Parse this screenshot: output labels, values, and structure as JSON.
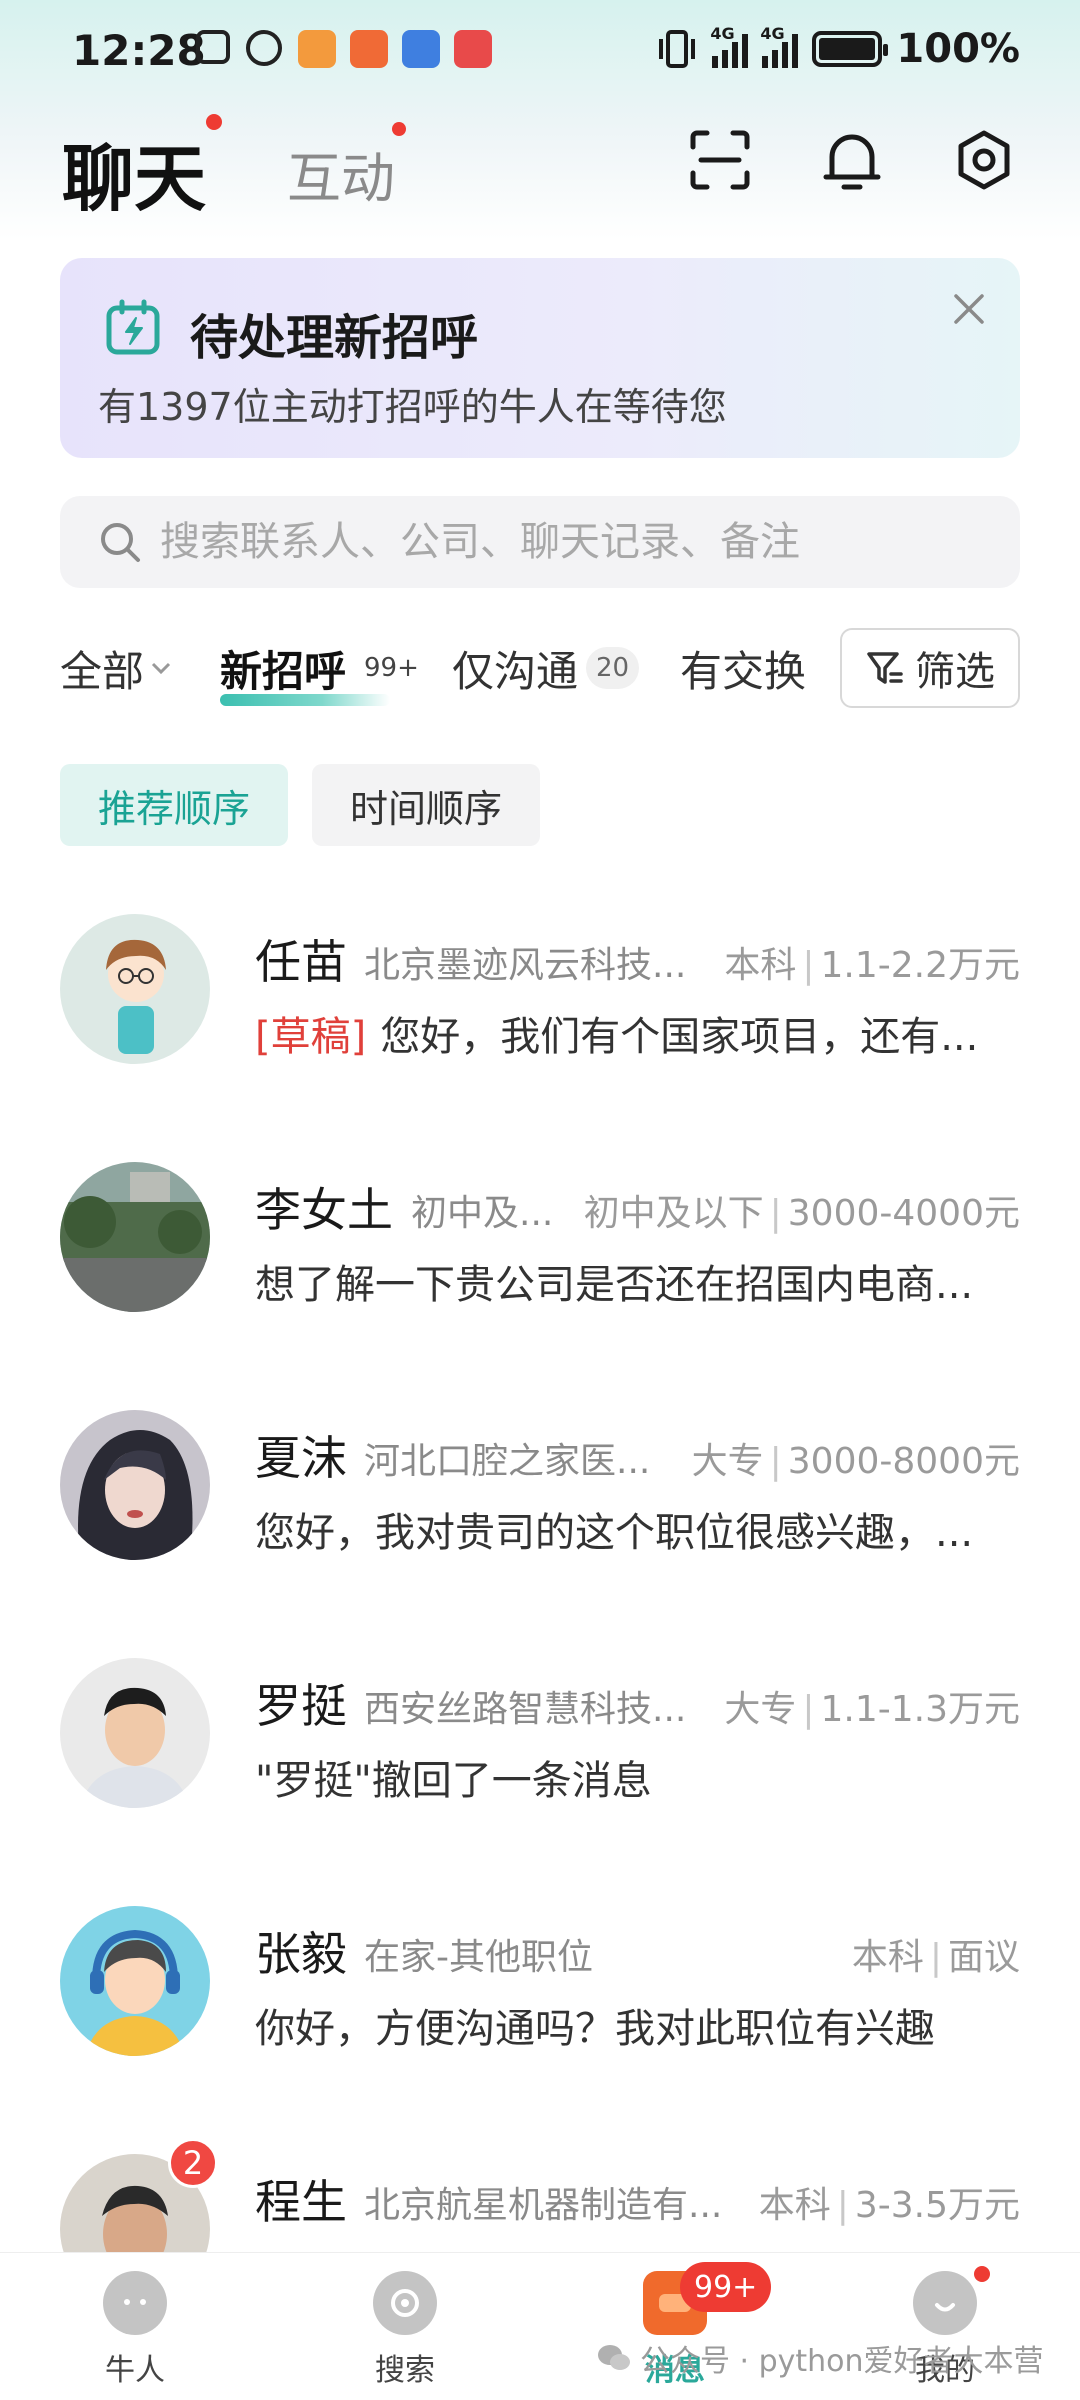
{
  "status_bar": {
    "time": "12:28",
    "signal_1_label": "4G",
    "signal_2_label": "4G",
    "battery": "100%"
  },
  "header": {
    "tab_chat": "聊天",
    "tab_interact": "互动",
    "icons": [
      "scan-icon",
      "bell-icon",
      "settings-icon"
    ]
  },
  "banner": {
    "title": "待处理新招呼",
    "description": "有1397位主动打招呼的牛人在等待您"
  },
  "search": {
    "placeholder": "搜索联系人、公司、聊天记录、备注"
  },
  "filter_tabs": {
    "all": "全部",
    "new_greet": "新招呼",
    "new_greet_badge": "99+",
    "only_chat": "仅沟通",
    "only_chat_badge": "20",
    "exchanged": "有交换",
    "filter_button": "筛选"
  },
  "sort": {
    "recommended": "推荐顺序",
    "time": "时间顺序"
  },
  "conversations": [
    {
      "name": "任苗",
      "company": "北京墨迹风云科技...",
      "education": "本科",
      "salary": "1.1-2.2万元",
      "draft_tag": "[草稿]",
      "message": "您好，我们有个国家项目，还有..."
    },
    {
      "name": "李女土",
      "company": "初中及...",
      "education": "初中及以下",
      "salary": "3000-4000元",
      "message": "想了解一下贵公司是否还在招国内电商..."
    },
    {
      "name": "夏沫",
      "company": "河北口腔之家医...",
      "education": "大专",
      "salary": "3000-8000元",
      "message": "您好，我对贵司的这个职位很感兴趣，..."
    },
    {
      "name": "罗挺",
      "company": "西安丝路智慧科技...",
      "education": "大专",
      "salary": "1.1-1.3万元",
      "message": "\"罗挺\"撤回了一条消息"
    },
    {
      "name": "张毅",
      "company": "在家-其他职位",
      "education": "本科",
      "salary": "面议",
      "message": "你好，方便沟通吗？我对此职位有兴趣"
    },
    {
      "name": "程生",
      "company": "北京航星机器制造有...",
      "education": "本科",
      "salary": "3-3.5万元",
      "unread": "2",
      "message": ""
    }
  ],
  "bottom_nav": {
    "talent": "牛人",
    "search": "搜索",
    "messages": "消息",
    "messages_badge": "99+",
    "mine": "我的"
  },
  "watermark": "公众号 · python爱好者大本营",
  "colors": {
    "accent": "#2aa89a",
    "badge_red": "#ee3b33",
    "draft_red": "#e0403a"
  }
}
